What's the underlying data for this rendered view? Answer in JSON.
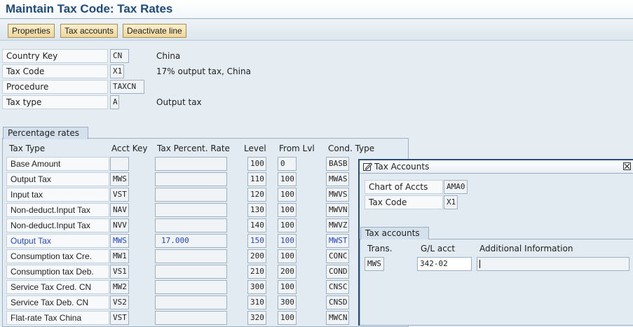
{
  "window": {
    "title": "Maintain Tax Code: Tax Rates"
  },
  "toolbar": {
    "properties": "Properties",
    "tax_accounts": "Tax accounts",
    "deactivate": "Deactivate line"
  },
  "header_fields": {
    "country_key": {
      "label": "Country Key",
      "value": "CN",
      "desc": "China"
    },
    "tax_code": {
      "label": "Tax Code",
      "value": "X1",
      "desc": "17% output tax, China"
    },
    "procedure": {
      "label": "Procedure",
      "value": "TAXCN"
    },
    "tax_type": {
      "label": "Tax type",
      "value": "A",
      "desc": "Output tax"
    }
  },
  "rates": {
    "group_title": "Percentage rates",
    "columns": {
      "tax_type": "Tax Type",
      "acct_key": "Acct Key",
      "percent": "Tax Percent. Rate",
      "level": "Level",
      "from_lvl": "From Lvl",
      "cond_type": "Cond. Type"
    },
    "rows": [
      {
        "tax_type": "Base Amount",
        "acct_key": "",
        "percent": "",
        "level": "100",
        "from_lvl": "0",
        "cond_type": "BASB",
        "highlight": false
      },
      {
        "tax_type": "Output Tax",
        "acct_key": "MWS",
        "percent": "",
        "level": "110",
        "from_lvl": "100",
        "cond_type": "MWAS",
        "highlight": false
      },
      {
        "tax_type": "Input tax",
        "acct_key": "VST",
        "percent": "",
        "level": "120",
        "from_lvl": "100",
        "cond_type": "MWVS",
        "highlight": false
      },
      {
        "tax_type": "Non-deduct.Input Tax",
        "acct_key": "NAV",
        "percent": "",
        "level": "130",
        "from_lvl": "100",
        "cond_type": "MWVN",
        "highlight": false
      },
      {
        "tax_type": "Non-deduct.Input Tax",
        "acct_key": "NVV",
        "percent": "",
        "level": "140",
        "from_lvl": "100",
        "cond_type": "MWVZ",
        "highlight": false
      },
      {
        "tax_type": "Output Tax",
        "acct_key": "MWS",
        "percent": "17.000",
        "level": "150",
        "from_lvl": "100",
        "cond_type": "MWST",
        "highlight": true
      },
      {
        "tax_type": "Consumption tax Cre.",
        "acct_key": "MW1",
        "percent": "",
        "level": "200",
        "from_lvl": "100",
        "cond_type": "CONC",
        "highlight": false
      },
      {
        "tax_type": "Consumption tax Deb.",
        "acct_key": "VS1",
        "percent": "",
        "level": "210",
        "from_lvl": "200",
        "cond_type": "COND",
        "highlight": false
      },
      {
        "tax_type": "Service Tax Cred. CN",
        "acct_key": "MW2",
        "percent": "",
        "level": "300",
        "from_lvl": "100",
        "cond_type": "CNSC",
        "highlight": false
      },
      {
        "tax_type": "Service Tax Deb. CN",
        "acct_key": "VS2",
        "percent": "",
        "level": "310",
        "from_lvl": "300",
        "cond_type": "CNSD",
        "highlight": false
      },
      {
        "tax_type": "Flat-rate Tax China",
        "acct_key": "VST",
        "percent": "",
        "level": "320",
        "from_lvl": "100",
        "cond_type": "MWCN",
        "highlight": false
      }
    ]
  },
  "popup": {
    "title": "Tax Accounts",
    "chart_of_accts": {
      "label": "Chart of Accts",
      "value": "AMA0"
    },
    "tax_code": {
      "label": "Tax Code",
      "value": "X1"
    },
    "group_title": "Tax accounts",
    "columns": {
      "trans": "Trans.",
      "gl_acct": "G/L acct",
      "additional": "Additional Information"
    },
    "row": {
      "trans": "MWS",
      "gl_acct": "342-02",
      "additional": ""
    }
  }
}
